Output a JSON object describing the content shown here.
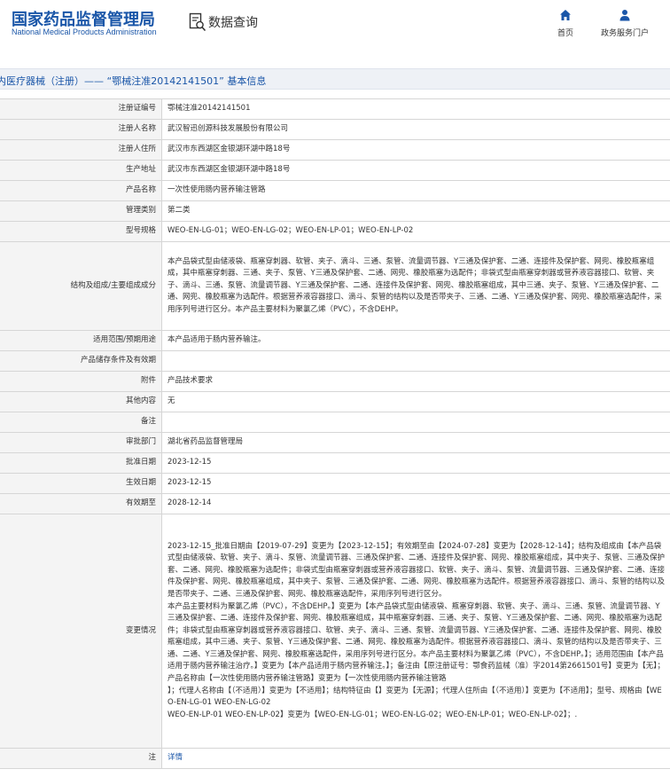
{
  "header": {
    "logo_title": "国家药品监督管理局",
    "logo_subtitle": "National Medical Products Administration",
    "query_label": "数据查询",
    "nav": [
      {
        "label": "首页",
        "icon": "home-icon"
      },
      {
        "label": "政务服务门户",
        "icon": "user-icon"
      }
    ],
    "brand_color": "#1a56a8"
  },
  "breadcrumb": "内医疗器械（注册）—— “鄂械注准20142141501”  基本信息",
  "rows": [
    {
      "label": "注册证编号",
      "value": "鄂械注准20142141501",
      "h": 23
    },
    {
      "label": "注册人名称",
      "value": "武汉智迅创源科技发展股份有限公司",
      "h": 23
    },
    {
      "label": "注册人住所",
      "value": "武汉市东西湖区金银湖环湖中路18号",
      "h": 23
    },
    {
      "label": "生产地址",
      "value": "武汉市东西湖区金银湖环湖中路18号",
      "h": 23
    },
    {
      "label": "产品名称",
      "value": "一次性使用肠内营养输注管路",
      "h": 23
    },
    {
      "label": "管理类别",
      "value": "第二类",
      "h": 23
    },
    {
      "label": "型号规格",
      "value": "WEO-EN-LG-01；WEO-EN-LG-02；WEO-EN-LP-01；WEO-EN-LP-02",
      "h": 23
    },
    {
      "label": "结构及组成/主要组成成分",
      "value": "本产品袋式型由储液袋、瓶塞穿刺器、软管、夹子、滴斗、三通、泵管、流量调节器、Y三通及保护套、二通、连接件及保护套、网兜、橡胶瓶塞组成，其中瓶塞穿刺器、三通、夹子、泵管、Y三通及保护套、二通、网兜、橡胶瓶塞为选配件；非袋式型由瓶塞穿刺器或营养液容器接口、软管、夹子、滴斗、三通、泵管、流量调节器、Y三通及保护套、二通、连接件及保护套、网兜、橡胶瓶塞组成，其中三通、夹子、泵管、Y三通及保护套、二通、网兜、橡胶瓶塞为选配件。根据营养液容器接口、滴斗、泵管的结构以及是否带夹子、三通、二通、Y三通及保护套、网兜、橡胶瓶塞选配件，采用序列号进行区分。本产品主要材料为聚氯乙烯（PVC），不含DEHP。",
      "h": 100
    },
    {
      "label": "适用范围/预期用途",
      "value": "本产品适用于肠内营养输注。",
      "h": 23
    },
    {
      "label": "产品储存条件及有效期",
      "value": "",
      "h": 23
    },
    {
      "label": "附件",
      "value": "产品技术要求",
      "h": 23
    },
    {
      "label": "其他内容",
      "value": "无",
      "h": 23
    },
    {
      "label": "备注",
      "value": "",
      "h": 23
    },
    {
      "label": "审批部门",
      "value": "湖北省药品监督管理局",
      "h": 23
    },
    {
      "label": "批准日期",
      "value": "2023-12-15",
      "h": 23
    },
    {
      "label": "生效日期",
      "value": "2023-12-15",
      "h": 23
    },
    {
      "label": "有效期至",
      "value": "2028-12-14",
      "h": 23
    },
    {
      "label": "变更情况",
      "value": "2023-12-15_批准日期由【2019-07-29】变更为【2023-12-15】；有效期至由【2024-07-28】变更为【2028-12-14】；结构及组成由【本产品袋式型由储液袋、软管、夹子、滴斗、泵管、流量调节器、三通及保护套、二通、连接件及保护套、网兜、橡胶瓶塞组成，其中夹子、泵管、三通及保护套、二通、网兜、橡胶瓶塞为选配件；非袋式型由瓶塞穿刺器或营养液容器接口、软管、夹子、滴斗、泵管、流量调节器、三通及保护套、二通、连接件及保护套、网兜、橡胶瓶塞组成，其中夹子、泵管、三通及保护套、二通、网兜、橡胶瓶塞为选配件。根据营养液容器接口、滴斗、泵管的结构以及是否带夹子、二通、三通及保护套、网兜、橡胶瓶塞选配件，采用序列号进行区分。\n本产品主要材料为聚氯乙烯（PVC），不含DEHP。】变更为【本产品袋式型由储液袋、瓶塞穿刺器、软管、夹子、滴斗、三通、泵管、流量调节器、Y三通及保护套、二通、连接件及保护套、网兜、橡胶瓶塞组成，其中瓶塞穿刺器、三通、夹子、泵管、Y三通及保护套、二通、网兜、橡胶瓶塞为选配件；非袋式型由瓶塞穿刺器或营养液容器接口、软管、夹子、滴斗、三通、泵管、流量调节器、Y三通及保护套、二通、连接件及保护套、网兜、橡胶瓶塞组成，其中三通、夹子、泵管、Y三通及保护套、二通、网兜、橡胶瓶塞为选配件。根据营养液容器接口、滴斗、泵管的结构以及是否带夹子、三通、二通、Y三通及保护套、网兜、橡胶瓶塞选配件，采用序列号进行区分。本产品主要材料为聚氯乙烯（PVC），不含DEHP。】；适用范围由【本产品适用于肠内营养输注治疗。】变更为【本产品适用于肠内营养输注。】；备注由【原注册证号：鄂食药监械（准）字2014第2661501号】变更为【无】；产品名称由【一次性使用肠内营养输注管路】变更为【一次性使用肠内营养输注管路\n】；代理人名称由【（不适用）】变更为【不适用】；结构特征由【】变更为【无源】；代理人住所由【（不适用）】变更为【不适用】；型号、规格由【WEO-EN-LG-01 WEO-EN-LG-02\nWEO-EN-LP-01 WEO-EN-LP-02】变更为【WEO-EN-LG-01；WEO-EN-LG-02；WEO-EN-LP-01；WEO-EN-LP-02】；.",
      "h": 264
    },
    {
      "label": "注",
      "value": "详情",
      "h": 23,
      "link": true
    }
  ]
}
